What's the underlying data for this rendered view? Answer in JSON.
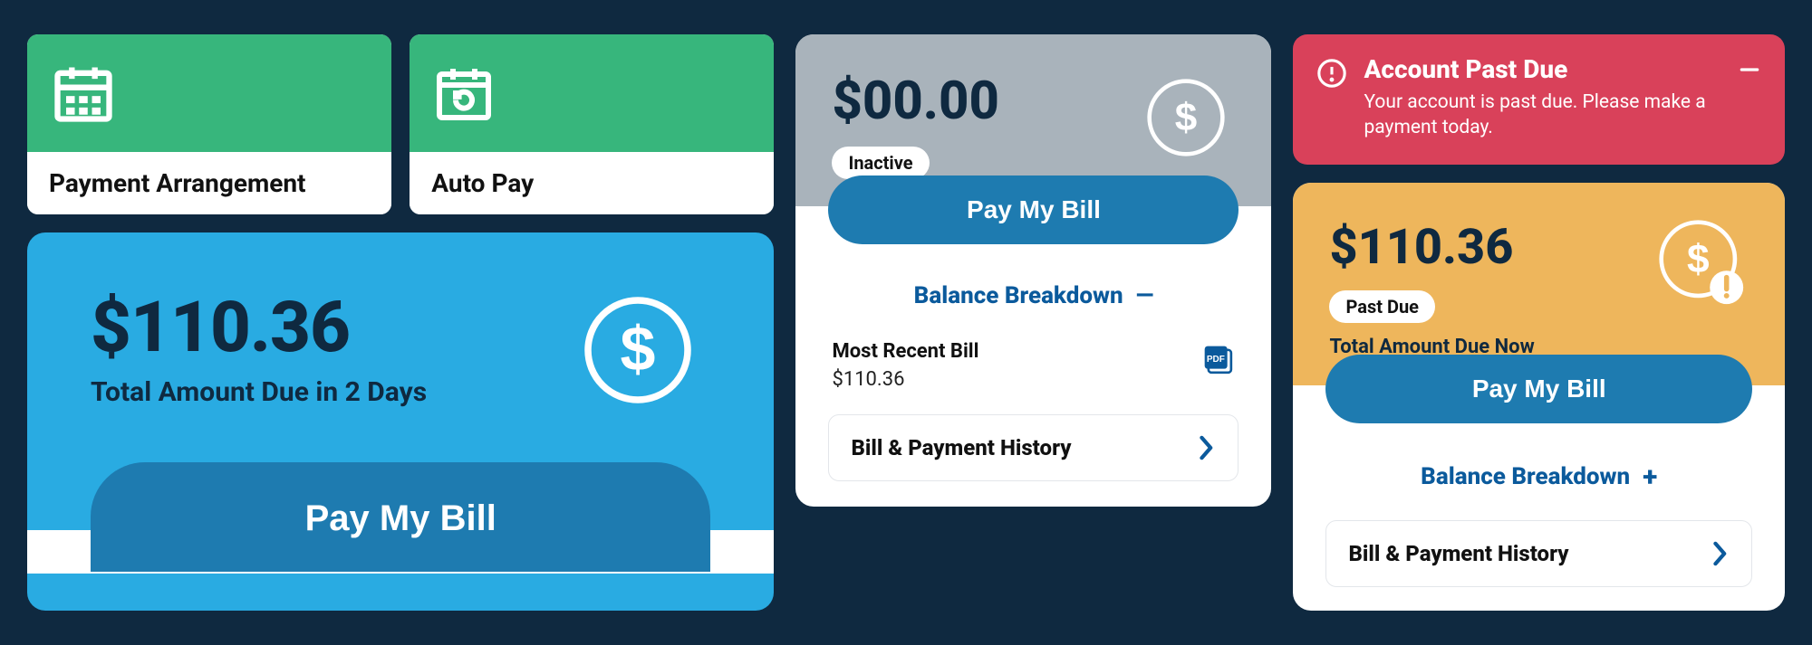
{
  "tiles": {
    "payment_arrangement": {
      "label": "Payment Arrangement"
    },
    "auto_pay": {
      "label": "Auto Pay"
    }
  },
  "main_card": {
    "amount": "$110.36",
    "subtitle": "Total Amount Due in 2 Days",
    "pay_button": "Pay My Bill"
  },
  "inactive_card": {
    "amount": "$00.00",
    "status_pill": "Inactive",
    "pay_button": "Pay My Bill",
    "breakdown_label": "Balance Breakdown",
    "breakdown_symbol": "—",
    "recent_label": "Most Recent Bill",
    "recent_value": "$110.36",
    "history_label": "Bill & Payment History"
  },
  "alert": {
    "title": "Account Past Due",
    "body": "Your account is past due. Please make a payment today."
  },
  "past_due_card": {
    "amount": "$110.36",
    "status_pill": "Past Due",
    "subtitle": "Total Amount Due Now",
    "pay_button": "Pay My Bill",
    "breakdown_label": "Balance Breakdown",
    "breakdown_symbol": "+",
    "history_label": "Bill & Payment History"
  }
}
